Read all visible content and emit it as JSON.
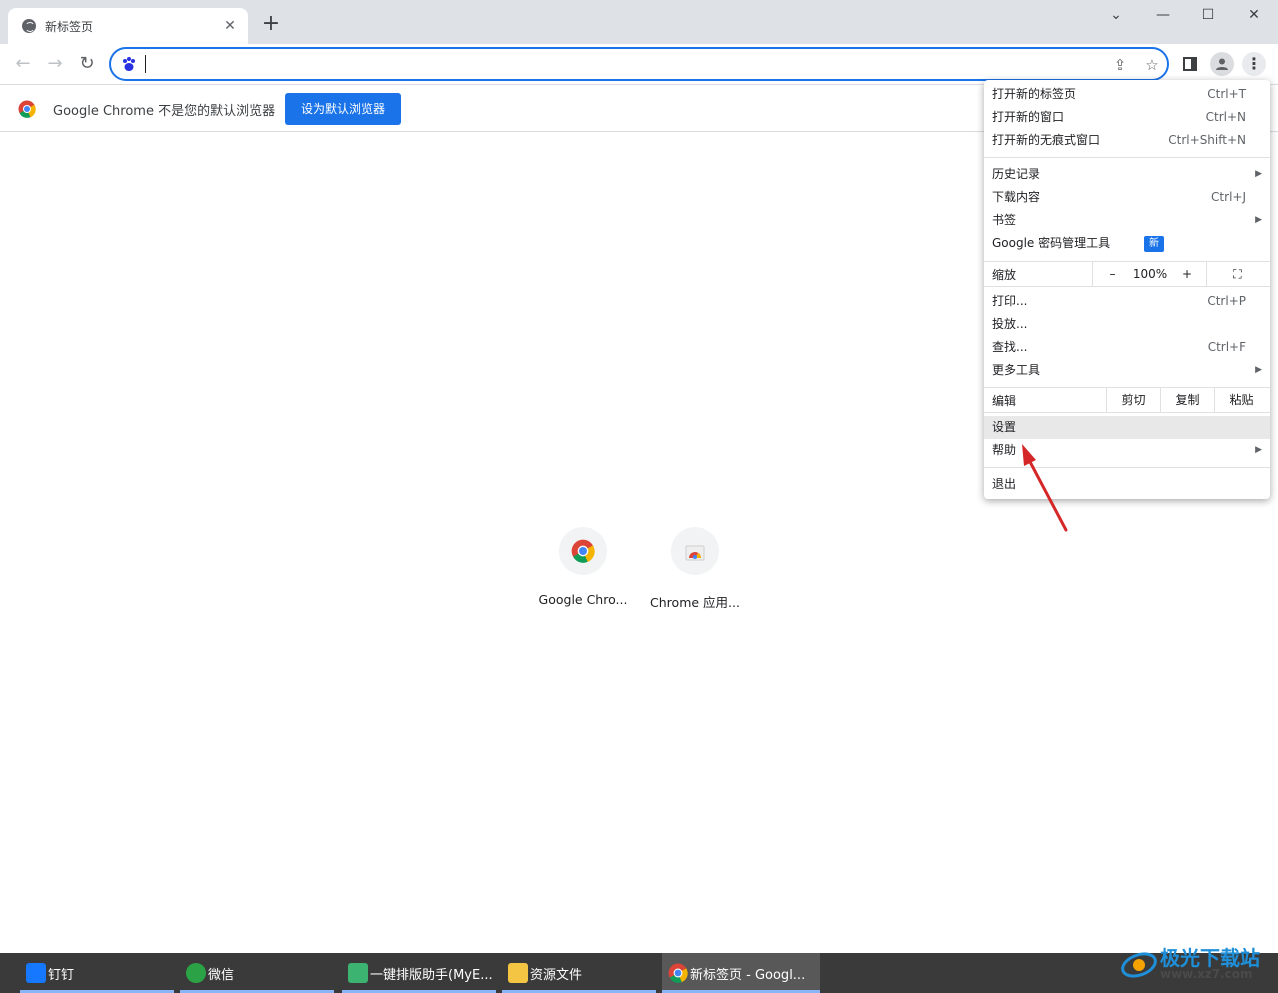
{
  "tab": {
    "title": "新标签页",
    "close": "✕"
  },
  "window_controls": {
    "tab_search": "⌄",
    "minimize": "—",
    "maximize": "☐",
    "close": "✕"
  },
  "toolbar": {
    "back": "←",
    "forward": "→",
    "reload": "↻",
    "address_value": ""
  },
  "infobar": {
    "message": "Google Chrome 不是您的默认浏览器",
    "button": "设为默认浏览器"
  },
  "shortcuts": [
    {
      "label": "Google Chro..."
    },
    {
      "label": "Chrome 应用..."
    }
  ],
  "menu": {
    "items_top": [
      {
        "label": "打开新的标签页",
        "key": "Ctrl+T"
      },
      {
        "label": "打开新的窗口",
        "key": "Ctrl+N"
      },
      {
        "label": "打开新的无痕式窗口",
        "key": "Ctrl+Shift+N"
      }
    ],
    "items_mid": [
      {
        "label": "历史记录",
        "key": ""
      },
      {
        "label": "下载内容",
        "key": "Ctrl+J"
      },
      {
        "label": "书签",
        "key": ""
      },
      {
        "label": "Google 密码管理工具",
        "key": ""
      }
    ],
    "new_badge": "新",
    "zoom": {
      "label": "缩放",
      "minus": "–",
      "value": "100%",
      "plus": "+"
    },
    "items_tools": [
      {
        "label": "打印...",
        "key": "Ctrl+P"
      },
      {
        "label": "投放...",
        "key": ""
      },
      {
        "label": "查找...",
        "key": "Ctrl+F"
      },
      {
        "label": "更多工具",
        "key": ""
      }
    ],
    "edit": {
      "label": "编辑",
      "cut": "剪切",
      "copy": "复制",
      "paste": "粘贴"
    },
    "settings": "设置",
    "help": "帮助",
    "exit": "退出"
  },
  "taskbar": [
    {
      "label": "钉钉",
      "color": "#1677ff"
    },
    {
      "label": "微信",
      "color": "#2ba245"
    },
    {
      "label": "一键排版助手(MyE...",
      "color": "#3cb371"
    },
    {
      "label": "资源文件",
      "color": "#f4c542"
    },
    {
      "label": "新标签页 - Googl...",
      "color": "#ea4335"
    }
  ],
  "watermark": {
    "text": "极光下载站",
    "url": "www.xz7.com"
  },
  "colors": {
    "accent": "#1a73e8",
    "annotation": "#d62728"
  }
}
